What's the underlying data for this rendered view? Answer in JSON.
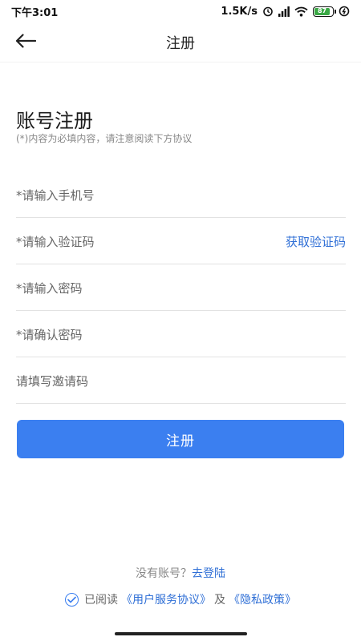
{
  "status_bar": {
    "time": "下午3:01",
    "network_speed": "1.5K/s",
    "battery_level": "87"
  },
  "nav": {
    "back_icon": "arrow-left-icon",
    "title": "注册"
  },
  "page": {
    "title": "账号注册",
    "subtitle": "(*)内容为必填内容，请注意阅读下方协议"
  },
  "form": {
    "phone_placeholder": "*请输入手机号",
    "code_placeholder": "*请输入验证码",
    "get_code_label": "获取验证码",
    "password_placeholder": "*请输入密码",
    "confirm_password_placeholder": "*请确认密码",
    "invite_placeholder": "请填写邀请码",
    "submit_label": "注册"
  },
  "footer": {
    "no_account_text": "没有账号？",
    "login_link": "去登陆",
    "read_text": "已阅读",
    "user_agreement": "《用户服务协议》",
    "and_text": "及",
    "privacy_policy": "《隐私政策》"
  },
  "colors": {
    "accent": "#3b7ff0",
    "link": "#2f6fd6"
  }
}
